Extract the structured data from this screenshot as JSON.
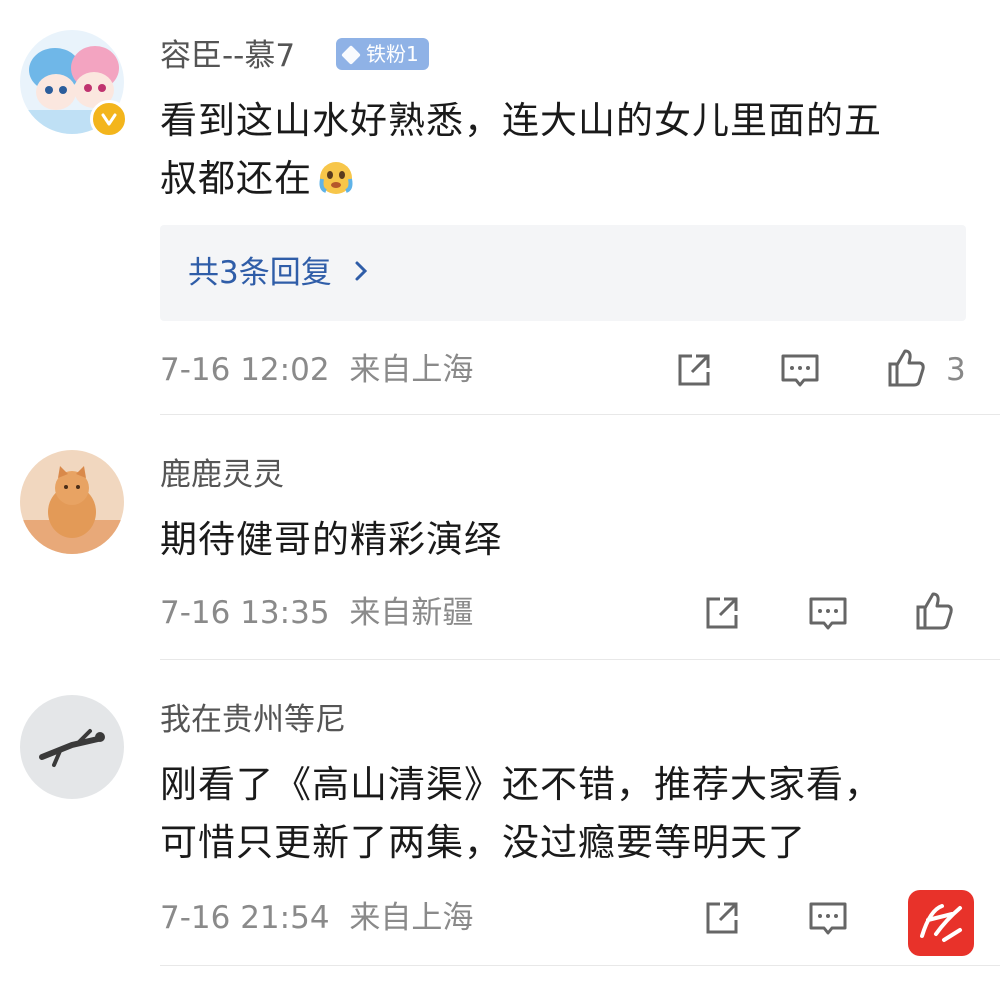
{
  "comments": [
    {
      "username": "容臣--慕7",
      "badge": "铁粉1",
      "text_line1": "看到这山水好熟悉，连大山的女儿里面的五",
      "text_line2": "叔都还在",
      "replies": "共3条回复",
      "time": "7-16 12:02",
      "location": "来自上海",
      "likes": "3",
      "avatar_icon": "anime-girl-avatar",
      "emoji": "crying-face-emoji"
    },
    {
      "username": "鹿鹿灵灵",
      "text_line1": "期待健哥的精彩演绎",
      "time": "7-16 13:35",
      "location": "来自新疆",
      "avatar_icon": "orange-cat-avatar"
    },
    {
      "username": "我在贵州等尼",
      "text_line1": "刚看了《高山清渠》还不错，推荐大家看，",
      "text_line2": "可惜只更新了两集，没过瘾要等明天了",
      "time": "7-16 21:54",
      "location": "来自上海",
      "avatar_icon": "snow-figure-avatar"
    }
  ],
  "colors": {
    "reply_link": "#2f5da8",
    "meta_text": "#8a8a8a",
    "badge_bg": "#8fb2e6",
    "watermark": "#e8322a"
  }
}
